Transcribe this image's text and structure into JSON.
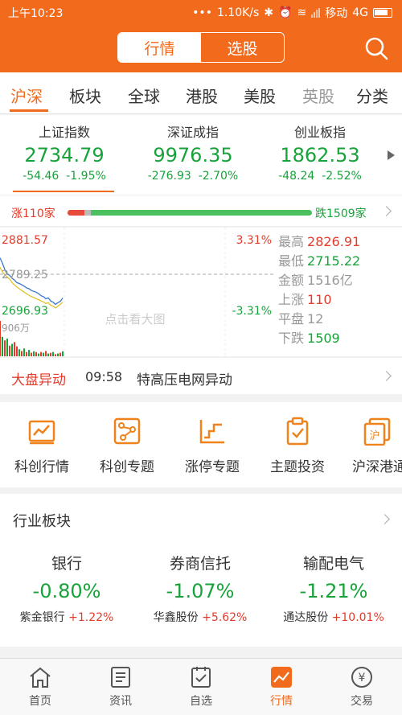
{
  "status_bar": {
    "time": "上午10:23",
    "speed": "1.10K/s",
    "carrier": "移动",
    "network": "4G"
  },
  "header": {
    "segments": [
      {
        "label": "行情",
        "active": true
      },
      {
        "label": "选股",
        "active": false
      }
    ]
  },
  "tabs": [
    {
      "label": "沪深",
      "active": true
    },
    {
      "label": "板块"
    },
    {
      "label": "全球"
    },
    {
      "label": "港股"
    },
    {
      "label": "美股"
    },
    {
      "label": "英股"
    },
    {
      "label": "分类"
    }
  ],
  "indices": [
    {
      "name": "上证指数",
      "value": "2734.79",
      "change": "-54.46",
      "pct": "-1.95%"
    },
    {
      "name": "深证成指",
      "value": "9976.35",
      "change": "-276.93",
      "pct": "-2.70%"
    },
    {
      "name": "创业板指",
      "value": "1862.53",
      "change": "-48.24",
      "pct": "-2.52%"
    }
  ],
  "breadth": {
    "up_label": "涨110家",
    "down_label": "跌1509家",
    "up": 110,
    "flat": 12,
    "down": 1509
  },
  "chart_panel": {
    "high_price": "2881.57",
    "high_pct": "3.31%",
    "mid_price": "2789.25",
    "low_price": "2696.93",
    "low_pct": "-3.31%",
    "volume": "906万",
    "overlay_text": "点击看大图",
    "stats": [
      {
        "label": "最高",
        "value": "2826.91",
        "color": "#e23c2c"
      },
      {
        "label": "最低",
        "value": "2715.22",
        "color": "#17a33a"
      },
      {
        "label": "金额",
        "value": "1516亿",
        "color": "#999999"
      },
      {
        "label": "上涨",
        "value": "110",
        "color": "#e23c2c"
      },
      {
        "label": "平盘",
        "value": "12",
        "color": "#999999"
      },
      {
        "label": "下跌",
        "value": "1509",
        "color": "#17a33a"
      }
    ]
  },
  "chart_data": {
    "type": "line",
    "ylim": [
      2696.93,
      2881.57
    ],
    "baseline": 2789.25,
    "series": [
      {
        "values": [
          2826.9,
          2815,
          2800,
          2790,
          2787,
          2780,
          2776,
          2770,
          2768,
          2765,
          2762,
          2758,
          2756,
          2752,
          2750,
          2748,
          2745,
          2740,
          2738,
          2733,
          2735,
          2728,
          2725,
          2720,
          2724,
          2727,
          2734.8
        ],
        "color": "#3b78d0"
      },
      {
        "values": [
          2805,
          2795,
          2788,
          2783,
          2778,
          2770,
          2765,
          2760,
          2756,
          2752,
          2748,
          2745,
          2741,
          2738,
          2736,
          2733,
          2731,
          2728,
          2726,
          2722,
          2724,
          2718,
          2716,
          2712,
          2716,
          2720,
          2725
        ],
        "color": "#e2c22c"
      }
    ],
    "volume_bars": [
      1.0,
      0.55,
      0.45,
      0.5,
      0.3,
      0.35,
      0.4,
      0.28,
      0.2,
      0.15,
      0.22,
      0.12,
      0.18,
      0.1,
      0.14,
      0.12,
      0.08,
      0.12,
      0.1,
      0.15,
      0.08,
      0.1,
      0.12,
      0.06,
      0.08,
      0.1,
      0.14
    ],
    "volume_colors": [
      "r",
      "g",
      "r",
      "g",
      "r",
      "g",
      "r",
      "r",
      "g",
      "r",
      "g",
      "r",
      "g",
      "r",
      "g",
      "r",
      "g",
      "r",
      "g",
      "r",
      "g",
      "r",
      "g",
      "r",
      "g",
      "r",
      "g"
    ]
  },
  "announcement": {
    "label": "大盘异动",
    "time": "09:58",
    "text": "特高压电网异动"
  },
  "features": [
    {
      "label": "科创行情",
      "icon": "chart-board-icon"
    },
    {
      "label": "科创专题",
      "icon": "graph-nodes-icon"
    },
    {
      "label": "涨停专题",
      "icon": "step-up-icon"
    },
    {
      "label": "主题投资",
      "icon": "clipboard-check-icon"
    },
    {
      "label": "沪深港通",
      "icon": "hu-badge-icon"
    }
  ],
  "industry": {
    "title": "行业板块",
    "sectors": [
      {
        "name": "银行",
        "pct": "-0.80%",
        "leader": "紫金银行",
        "leader_pct": "+1.22%"
      },
      {
        "name": "券商信托",
        "pct": "-1.07%",
        "leader": "华鑫股份",
        "leader_pct": "+5.62%"
      },
      {
        "name": "输配电气",
        "pct": "-1.21%",
        "leader": "通达股份",
        "leader_pct": "+10.01%"
      }
    ]
  },
  "bottom_nav": [
    {
      "label": "首页",
      "icon": "home-icon"
    },
    {
      "label": "资讯",
      "icon": "news-icon"
    },
    {
      "label": "自选",
      "icon": "watchlist-icon"
    },
    {
      "label": "行情",
      "icon": "market-icon",
      "active": true
    },
    {
      "label": "交易",
      "icon": "trade-yen-icon"
    }
  ],
  "colors": {
    "accent": "#f26a1b",
    "up": "#e23c2c",
    "down": "#17a33a"
  }
}
